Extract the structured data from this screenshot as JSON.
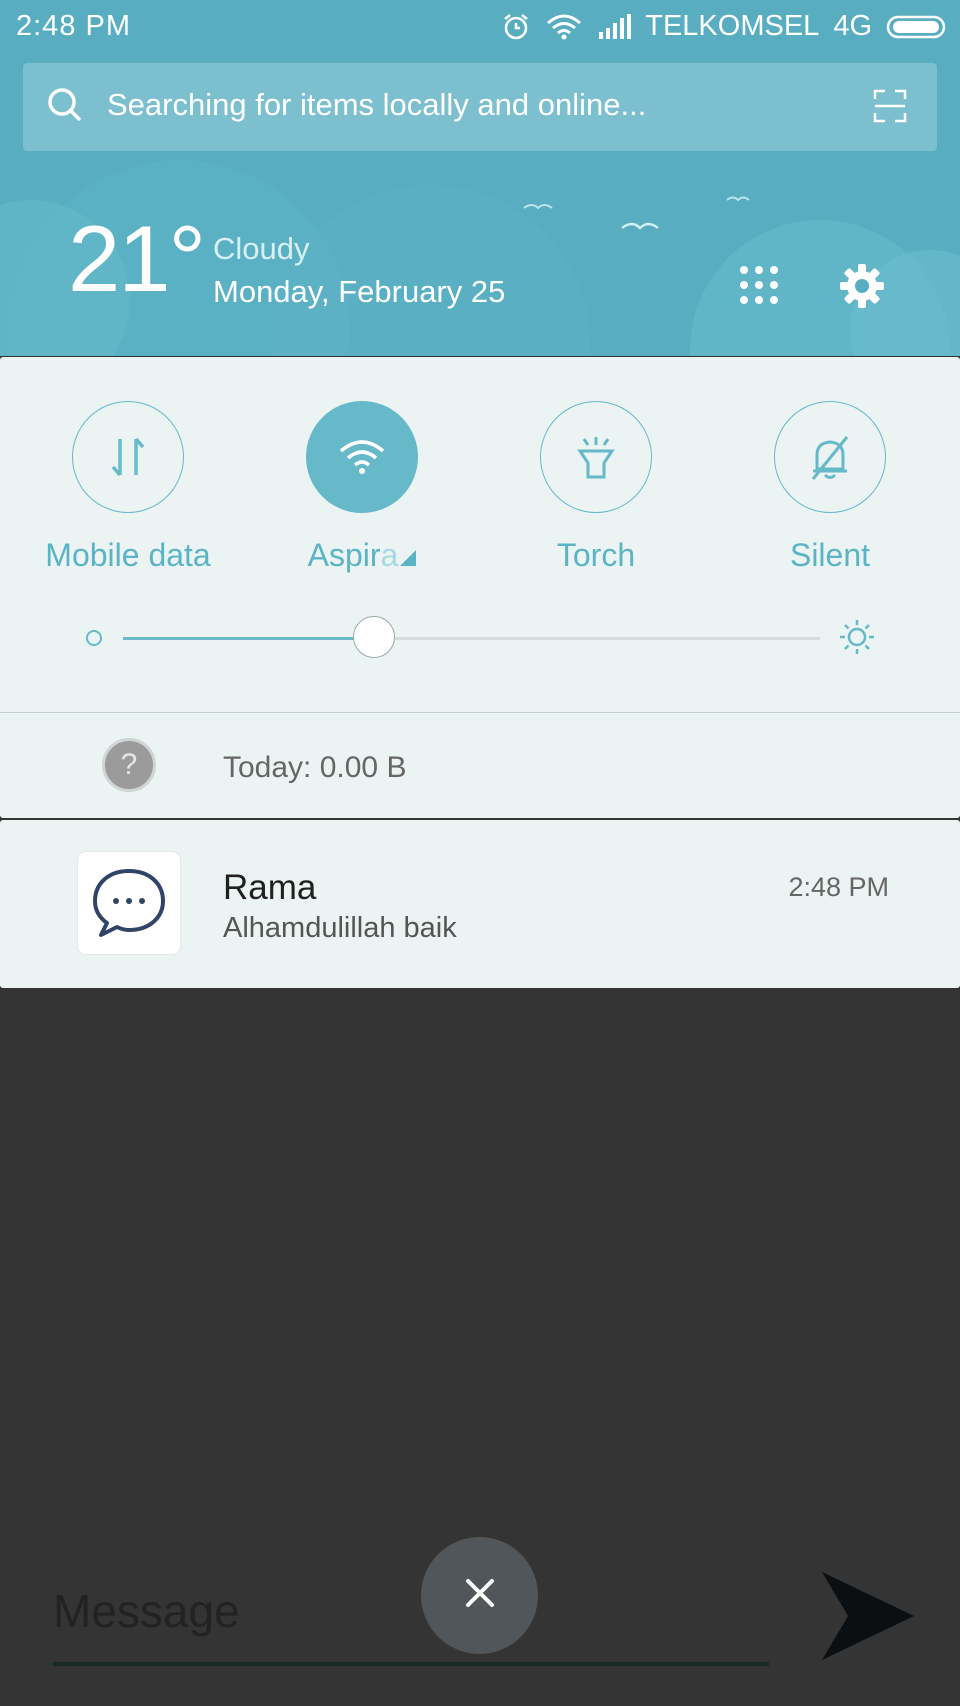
{
  "status_bar": {
    "time": "2:48 PM",
    "carrier": "TELKOMSEL",
    "network": "4G",
    "icons": [
      "alarm-icon",
      "wifi-icon",
      "signal-icon",
      "battery-icon"
    ]
  },
  "search": {
    "placeholder": "Searching for items locally and online...",
    "icons": [
      "search-icon",
      "scan-icon"
    ]
  },
  "weather": {
    "temperature": "21°",
    "condition": "Cloudy",
    "date": "Monday, February 25"
  },
  "header_actions": [
    "apps-grid-icon",
    "settings-gear-icon"
  ],
  "quick_settings": {
    "tiles": [
      {
        "label": "Mobile data",
        "icon": "mobile-data-icon",
        "active": false
      },
      {
        "label": "Aspira",
        "label_main": "Aspir",
        "label_fade": "a",
        "icon": "wifi-icon",
        "active": true
      },
      {
        "label": "Torch",
        "icon": "torch-icon",
        "active": false
      },
      {
        "label": "Silent",
        "icon": "silent-bell-icon",
        "active": false
      }
    ],
    "brightness_level": 0.36
  },
  "data_usage": {
    "text": "Today: 0.00 B",
    "icon": "?"
  },
  "notification": {
    "app_icon": "chat-bubble-icon",
    "title": "Rama",
    "body": "Alhamdulillah baik",
    "time": "2:48 PM"
  },
  "composer": {
    "placeholder": "Message",
    "icons": [
      "close-icon",
      "send-icon"
    ]
  },
  "colors": {
    "header": "#58aec0",
    "accent": "#66b9c9",
    "panel": "#ebf3f3",
    "background": "#343434"
  }
}
